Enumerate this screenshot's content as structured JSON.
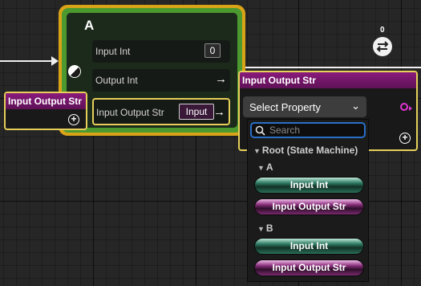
{
  "node_a": {
    "title": "A",
    "rows": [
      {
        "label": "Input Int",
        "value": "0"
      },
      {
        "label": "Output Int"
      },
      {
        "label": "Input Output Str",
        "value": "Input"
      }
    ]
  },
  "left_node": {
    "title": "Input Output Str"
  },
  "right_node": {
    "title": "Input Output Str",
    "select_label": "Select Property"
  },
  "transition": {
    "count": "0"
  },
  "dropdown": {
    "search_placeholder": "Search",
    "root_label": "Root (State Machine)",
    "groups": [
      {
        "label": "A",
        "items": [
          {
            "label": "Input Int",
            "type": "int"
          },
          {
            "label": "Input Output Str",
            "type": "string"
          }
        ]
      },
      {
        "label": "B",
        "items": [
          {
            "label": "Input Int",
            "type": "int"
          },
          {
            "label": "Input Output Str",
            "type": "string"
          }
        ]
      }
    ]
  },
  "colors": {
    "selection_outline": "#e6cf5a",
    "active_state": "#4c9a2f",
    "node_border_active": "#d9a317",
    "string_pin": "#e233d2",
    "int_pill": "#2f7c64",
    "string_pill": "#8b2f7d",
    "search_focus": "#2a6fc7"
  }
}
